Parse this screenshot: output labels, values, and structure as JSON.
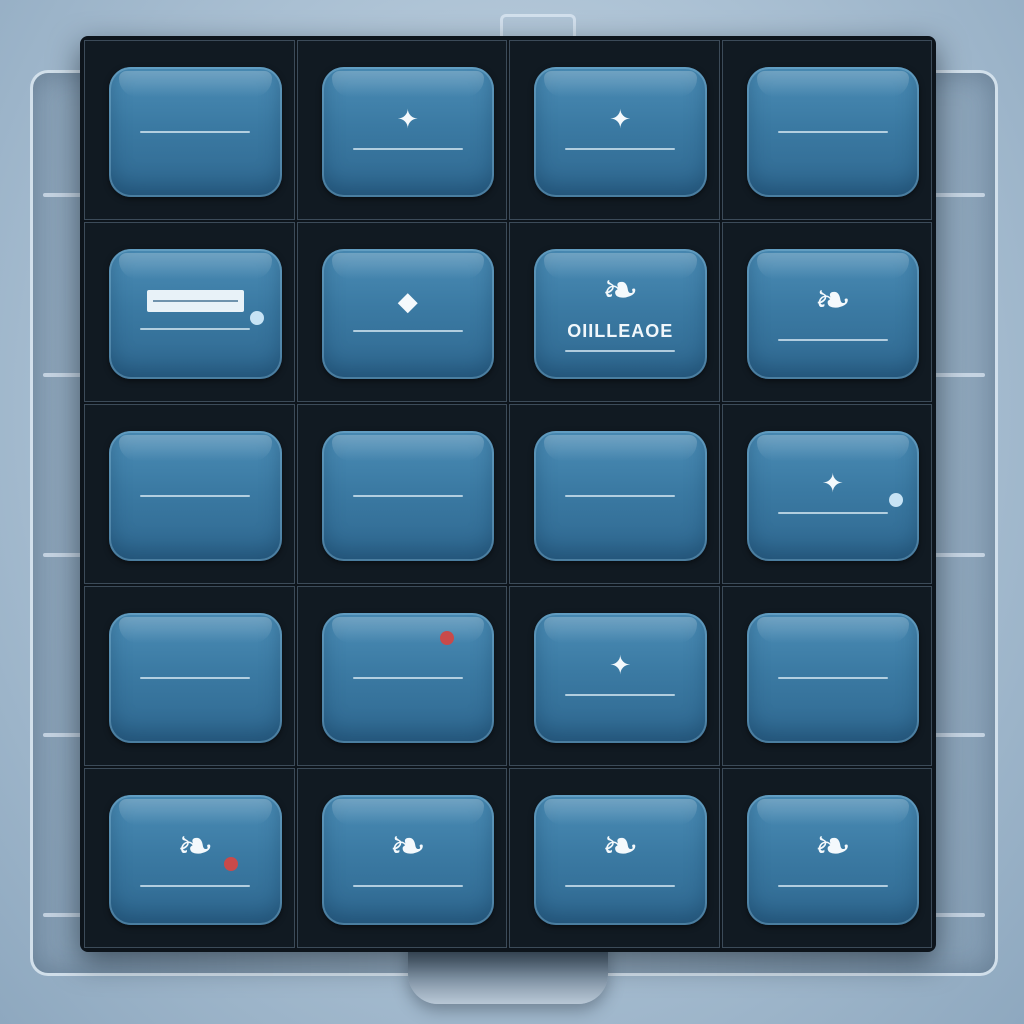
{
  "colors": {
    "screen": "#3b7aa3",
    "panel": "#0d141b",
    "text": "#f1f7fb",
    "dot_light": "#c7e3f5",
    "dot_red": "#c94a4a"
  },
  "tiles": [
    {
      "header": "",
      "title": "",
      "sub": "",
      "footer": "",
      "icon": ""
    },
    {
      "header": "",
      "title": "",
      "sub": "",
      "footer": "",
      "icon": "star-icon"
    },
    {
      "header": "",
      "title": "",
      "sub": "",
      "footer": "",
      "icon": "star-icon"
    },
    {
      "header": "",
      "title": "",
      "sub": "",
      "footer": "",
      "icon": ""
    },
    {
      "header": "",
      "title": "",
      "sub": "",
      "footer": "",
      "icon": "input-bar"
    },
    {
      "header": "",
      "title": "",
      "sub": "",
      "footer": "",
      "icon": "drop-icon"
    },
    {
      "header": "",
      "title": "OIILLEAOE",
      "sub": "",
      "footer": "",
      "icon": "leaf-icon"
    },
    {
      "header": "",
      "title": "",
      "sub": "",
      "footer": "",
      "icon": "leaf-icon"
    },
    {
      "header": "",
      "title": "",
      "sub": "",
      "footer": "",
      "icon": ""
    },
    {
      "header": "",
      "title": "",
      "sub": "",
      "footer": "",
      "icon": ""
    },
    {
      "header": "",
      "title": "",
      "sub": "",
      "footer": "",
      "icon": ""
    },
    {
      "header": "",
      "title": "",
      "sub": "",
      "footer": "",
      "icon": "star-icon"
    },
    {
      "header": "",
      "title": "",
      "sub": "",
      "footer": "",
      "icon": ""
    },
    {
      "header": "",
      "title": "",
      "sub": "",
      "footer": "",
      "icon": ""
    },
    {
      "header": "",
      "title": "",
      "sub": "",
      "footer": "",
      "icon": "star-icon"
    },
    {
      "header": "",
      "title": "",
      "sub": "",
      "footer": "",
      "icon": ""
    },
    {
      "header": "",
      "title": "",
      "sub": "",
      "footer": "",
      "icon": "leaf-icon"
    },
    {
      "header": "",
      "title": "",
      "sub": "",
      "footer": "",
      "icon": "leaf-icon"
    },
    {
      "header": "",
      "title": "",
      "sub": "",
      "footer": "",
      "icon": "leaf-icon"
    },
    {
      "header": "",
      "title": "",
      "sub": "",
      "footer": "",
      "icon": "leaf-icon"
    }
  ]
}
